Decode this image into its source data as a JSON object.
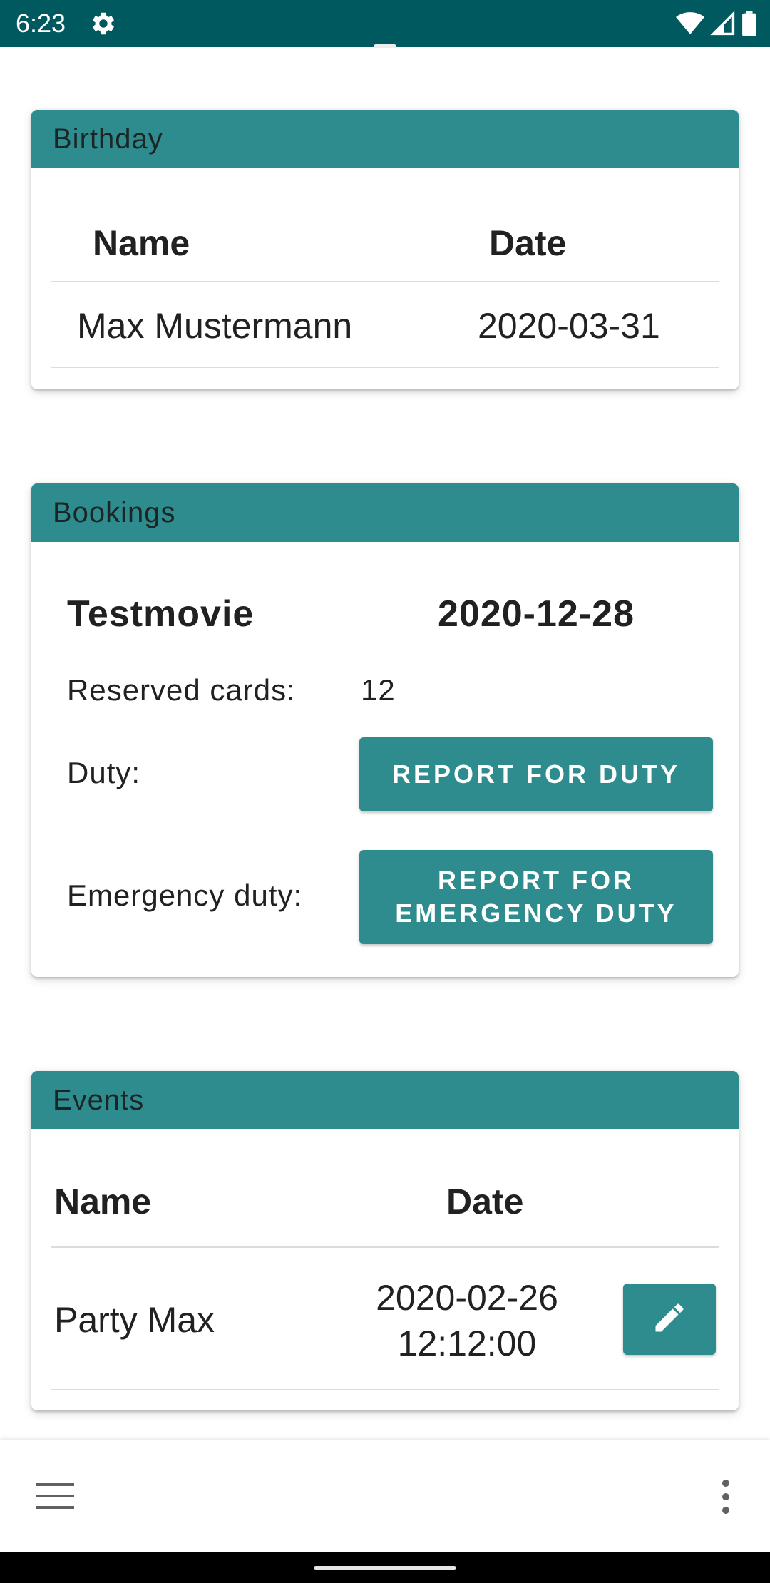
{
  "status_bar": {
    "time": "6:23",
    "icons": [
      "gear-icon",
      "wifi-icon",
      "signal-icon",
      "battery-icon"
    ],
    "background": "#00595f"
  },
  "theme": {
    "accent": "#2e8c8e"
  },
  "birthday": {
    "header": "Birthday",
    "columns": [
      "Name",
      "Date"
    ],
    "rows": [
      {
        "name": "Max Mustermann",
        "date": "2020-03-31"
      }
    ]
  },
  "bookings": {
    "header": "Bookings",
    "movie": "Testmovie",
    "date": "2020-12-28",
    "reserved_label": "Reserved cards:",
    "reserved_value": "12",
    "duty_label": "Duty:",
    "duty_button": "REPORT FOR DUTY",
    "emergency_label": "Emergency duty:",
    "emergency_button": "REPORT FOR EMERGENCY DUTY"
  },
  "events": {
    "header": "Events",
    "columns": [
      "Name",
      "Date"
    ],
    "rows": [
      {
        "name": "Party Max",
        "date_line1": "2020-02-26",
        "date_line2": "12:12:00",
        "action_icon": "edit-icon"
      }
    ]
  },
  "bottom_bar": {
    "left_icon": "menu-icon",
    "right_icon": "more-vert-icon"
  }
}
